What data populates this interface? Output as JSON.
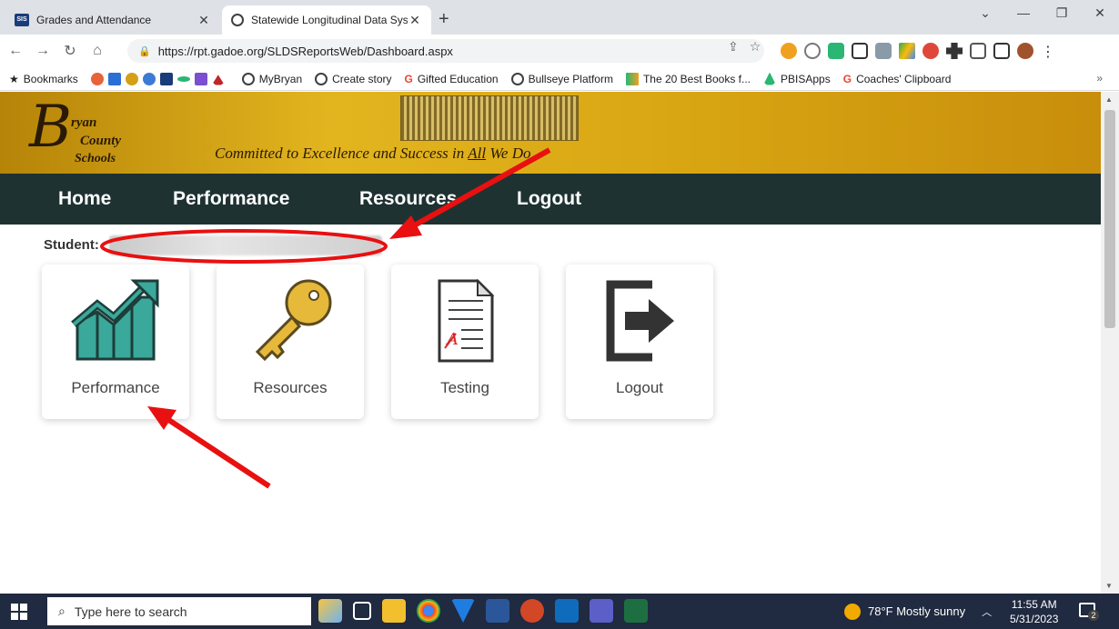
{
  "browser": {
    "tabs": [
      {
        "title": "Grades and Attendance",
        "favicon": "sis-icon"
      },
      {
        "title": "Statewide Longitudinal Data Syst",
        "favicon": "globe-icon"
      }
    ],
    "url": "https://rpt.gadoe.org/SLDSReportsWeb/Dashboard.aspx",
    "bookmarks": [
      {
        "label": "Bookmarks"
      },
      {
        "label": "MyBryan"
      },
      {
        "label": "Create story"
      },
      {
        "label": "Gifted Education"
      },
      {
        "label": "Bullseye Platform"
      },
      {
        "label": "The 20 Best Books f..."
      },
      {
        "label": "PBISApps"
      },
      {
        "label": "Coaches' Clipboard"
      }
    ],
    "bookmarks_more": "»"
  },
  "site": {
    "logo": {
      "line1": "ryan",
      "line2": "County",
      "line3": "Schools",
      "initial": "B"
    },
    "tagline_pre": "Committed to Excellence and Success in ",
    "tagline_underlined": "All",
    "tagline_post": " We Do",
    "nav": [
      "Home",
      "Performance",
      "Resources",
      "Logout"
    ],
    "student_label": "Student:",
    "cards": [
      {
        "label": "Performance",
        "icon": "chart-growth-icon"
      },
      {
        "label": "Resources",
        "icon": "key-icon"
      },
      {
        "label": "Testing",
        "icon": "test-document-icon"
      },
      {
        "label": "Logout",
        "icon": "logout-icon"
      }
    ]
  },
  "taskbar": {
    "search_placeholder": "Type here to search",
    "weather": "78°F  Mostly sunny",
    "time": "11:55 AM",
    "date": "5/31/2023",
    "notifications": "2"
  },
  "colors": {
    "navbar": "#1f3232",
    "banner": "#d9a713",
    "annotation_arrow": "#e81010"
  }
}
